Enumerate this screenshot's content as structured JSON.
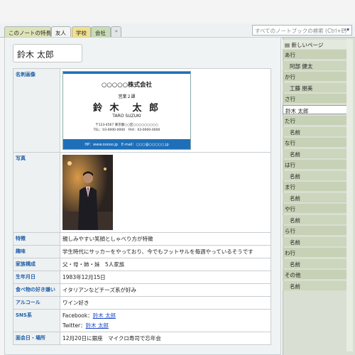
{
  "tabs": {
    "notebook": "このノートの特長",
    "friends": "友人",
    "school": "学校",
    "company": "会社",
    "new": "*"
  },
  "search": {
    "placeholder": "すべてのノートブックの検索 (Ctrl+E)",
    "icon": "search-icon"
  },
  "page": {
    "title": "鈴木 太郎",
    "rows": [
      {
        "label": "名刺画像"
      },
      {
        "label": "写真"
      },
      {
        "label": "特徴",
        "value": "親しみやすい笑顔としゃべり方が特徴"
      },
      {
        "label": "趣味",
        "value": "学生時代にサッカーをやっており、今でもフットサルを毎週やっているそうです"
      },
      {
        "label": "家族構成",
        "value": "父・母・姉・妹　5人家族"
      },
      {
        "label": "生年月日",
        "value": "1983年12月15日"
      },
      {
        "label": "食べ物の好き嫌い",
        "value": "イタリアンなどチーズ系が好み"
      },
      {
        "label": "アルコール",
        "value": "ワイン好き"
      },
      {
        "label": "SNS系",
        "fb_prefix": "Facebook：",
        "fb_link": "鈴木 太郎",
        "tw_prefix": "Twitter：",
        "tw_link": "鈴木 太郎"
      },
      {
        "label": "面会日・場所",
        "value": "12月20日に銀座　マイクロ寿司で忘年会"
      }
    ]
  },
  "card": {
    "company": "○○○○○株式会社",
    "dept": "営業２課",
    "name": "鈴 木　太 郎",
    "romaji": "TARO SUZUKI",
    "address": "〒123-4567 東京都○○区○○○○○○○○○",
    "tel": "TEL：03-0000-0000　FAX：03-0000-0000",
    "footer": "HP：www.ooooo.jp　E-mail：○○○@○○○○○.jp"
  },
  "sidebar": {
    "new_page": "新しいページ",
    "items": [
      {
        "label": "あ行",
        "type": "grp"
      },
      {
        "label": "阿部 健太",
        "type": "sub"
      },
      {
        "label": "か行",
        "type": "grp"
      },
      {
        "label": "工藤 朋美",
        "type": "sub"
      },
      {
        "label": "さ行",
        "type": "grp"
      },
      {
        "label": "鈴木 太郎",
        "type": "sel"
      },
      {
        "label": "た行",
        "type": "grp"
      },
      {
        "label": "名前",
        "type": "sub"
      },
      {
        "label": "な行",
        "type": "grp"
      },
      {
        "label": "名前",
        "type": "sub"
      },
      {
        "label": "は行",
        "type": "grp"
      },
      {
        "label": "名前",
        "type": "sub"
      },
      {
        "label": "ま行",
        "type": "grp"
      },
      {
        "label": "名前",
        "type": "sub"
      },
      {
        "label": "や行",
        "type": "grp"
      },
      {
        "label": "名前",
        "type": "sub"
      },
      {
        "label": "ら行",
        "type": "grp"
      },
      {
        "label": "名前",
        "type": "sub"
      },
      {
        "label": "わ行",
        "type": "grp"
      },
      {
        "label": "名前",
        "type": "sub"
      },
      {
        "label": "その他",
        "type": "grp"
      },
      {
        "label": "名前",
        "type": "sub"
      }
    ]
  }
}
